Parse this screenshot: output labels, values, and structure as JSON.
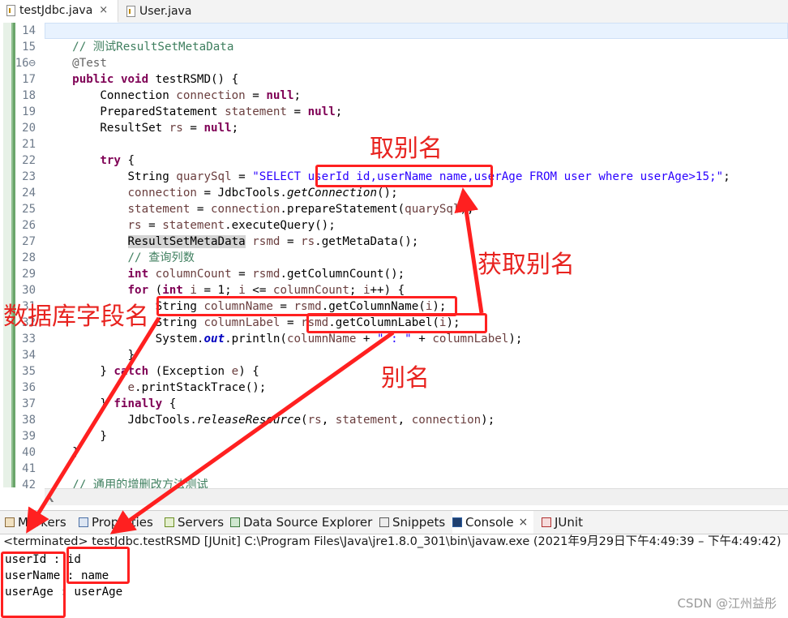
{
  "editor_tabs": [
    {
      "label": "testJdbc.java",
      "close": "×",
      "active": true
    },
    {
      "label": "User.java",
      "active": false
    }
  ],
  "code_lines": [
    {
      "n": "14",
      "t": []
    },
    {
      "n": "15",
      "t": [
        [
          "    ",
          ""
        ],
        [
          "// 测试ResultSetMetaData",
          "cm"
        ]
      ]
    },
    {
      "n": "16⊖",
      "t": [
        [
          "    ",
          ""
        ],
        [
          "@Test",
          "ann"
        ]
      ]
    },
    {
      "n": "17",
      "t": [
        [
          "    ",
          ""
        ],
        [
          "public",
          "kw"
        ],
        [
          " ",
          ""
        ],
        [
          "void",
          "kw"
        ],
        [
          " testRSMD() {",
          ""
        ]
      ]
    },
    {
      "n": "18",
      "t": [
        [
          "        Connection ",
          ""
        ],
        [
          "connection",
          "var"
        ],
        [
          " = ",
          ""
        ],
        [
          "null",
          "kw"
        ],
        [
          ";",
          ""
        ]
      ]
    },
    {
      "n": "19",
      "t": [
        [
          "        PreparedStatement ",
          ""
        ],
        [
          "statement",
          "var"
        ],
        [
          " = ",
          ""
        ],
        [
          "null",
          "kw"
        ],
        [
          ";",
          ""
        ]
      ]
    },
    {
      "n": "20",
      "t": [
        [
          "        ResultSet ",
          ""
        ],
        [
          "rs",
          "var"
        ],
        [
          " = ",
          ""
        ],
        [
          "null",
          "kw"
        ],
        [
          ";",
          ""
        ]
      ]
    },
    {
      "n": "21",
      "t": []
    },
    {
      "n": "22",
      "t": [
        [
          "        ",
          ""
        ],
        [
          "try",
          "kw"
        ],
        [
          " {",
          ""
        ]
      ]
    },
    {
      "n": "23",
      "t": [
        [
          "            String ",
          ""
        ],
        [
          "quarySql",
          "var"
        ],
        [
          " = ",
          ""
        ],
        [
          "\"SELECT userId id,userName name,userAge FROM user where userAge>15;\"",
          "str"
        ],
        [
          ";",
          ""
        ]
      ]
    },
    {
      "n": "24",
      "t": [
        [
          "            ",
          ""
        ],
        [
          "connection",
          "var"
        ],
        [
          " = JdbcTools.",
          ""
        ],
        [
          "getConnection",
          "it"
        ],
        [
          "();",
          ""
        ]
      ]
    },
    {
      "n": "25",
      "t": [
        [
          "            ",
          ""
        ],
        [
          "statement",
          "var"
        ],
        [
          " = ",
          ""
        ],
        [
          "connection",
          "var"
        ],
        [
          ".prepareStatement(",
          ""
        ],
        [
          "quarySql",
          "var"
        ],
        [
          ");",
          ""
        ]
      ]
    },
    {
      "n": "26",
      "t": [
        [
          "            ",
          ""
        ],
        [
          "rs",
          "var"
        ],
        [
          " = ",
          ""
        ],
        [
          "statement",
          "var"
        ],
        [
          ".executeQuery();",
          ""
        ]
      ]
    },
    {
      "n": "27",
      "t": [
        [
          "            ",
          ""
        ],
        [
          "ResultSetMetaData",
          "hl-box"
        ],
        [
          " ",
          ""
        ],
        [
          "rsmd",
          "var"
        ],
        [
          " = ",
          ""
        ],
        [
          "rs",
          "var"
        ],
        [
          ".getMetaData();",
          ""
        ]
      ]
    },
    {
      "n": "28",
      "t": [
        [
          "            ",
          ""
        ],
        [
          "// 查询列数",
          "cm"
        ]
      ]
    },
    {
      "n": "29",
      "t": [
        [
          "            ",
          ""
        ],
        [
          "int",
          "kw"
        ],
        [
          " ",
          ""
        ],
        [
          "columnCount",
          "var"
        ],
        [
          " = ",
          ""
        ],
        [
          "rsmd",
          "var"
        ],
        [
          ".getColumnCount();",
          ""
        ]
      ]
    },
    {
      "n": "30",
      "t": [
        [
          "            ",
          ""
        ],
        [
          "for",
          "kw"
        ],
        [
          " (",
          ""
        ],
        [
          "int",
          "kw"
        ],
        [
          " ",
          ""
        ],
        [
          "i",
          "var"
        ],
        [
          " = 1; ",
          ""
        ],
        [
          "i",
          "var"
        ],
        [
          " <= ",
          ""
        ],
        [
          "columnCount",
          "var"
        ],
        [
          "; ",
          ""
        ],
        [
          "i",
          "var"
        ],
        [
          "++) {",
          ""
        ]
      ]
    },
    {
      "n": "31",
      "t": [
        [
          "                String ",
          ""
        ],
        [
          "columnName",
          "var"
        ],
        [
          " = ",
          ""
        ],
        [
          "rsmd",
          "var"
        ],
        [
          ".getColumnName(",
          ""
        ],
        [
          "i",
          "var"
        ],
        [
          ");",
          ""
        ]
      ]
    },
    {
      "n": "32",
      "t": [
        [
          "                String ",
          ""
        ],
        [
          "columnLabel",
          "var"
        ],
        [
          " = ",
          ""
        ],
        [
          "rsmd",
          "var"
        ],
        [
          ".getColumnLabel(",
          ""
        ],
        [
          "i",
          "var"
        ],
        [
          ");",
          ""
        ]
      ]
    },
    {
      "n": "33",
      "t": [
        [
          "                System.",
          ""
        ],
        [
          "out",
          "sfi"
        ],
        [
          ".println(",
          ""
        ],
        [
          "columnName",
          "var"
        ],
        [
          " + ",
          ""
        ],
        [
          "\" : \"",
          "str"
        ],
        [
          " + ",
          ""
        ],
        [
          "columnLabel",
          "var"
        ],
        [
          ");",
          ""
        ]
      ]
    },
    {
      "n": "34",
      "t": [
        [
          "            }",
          ""
        ]
      ]
    },
    {
      "n": "35",
      "t": [
        [
          "        } ",
          ""
        ],
        [
          "catch",
          "kw"
        ],
        [
          " (Exception ",
          ""
        ],
        [
          "e",
          "var"
        ],
        [
          ") {",
          ""
        ]
      ]
    },
    {
      "n": "36",
      "t": [
        [
          "            ",
          ""
        ],
        [
          "e",
          "var"
        ],
        [
          ".printStackTrace();",
          ""
        ]
      ]
    },
    {
      "n": "37",
      "t": [
        [
          "        } ",
          ""
        ],
        [
          "finally",
          "kw"
        ],
        [
          " {",
          ""
        ]
      ]
    },
    {
      "n": "38",
      "t": [
        [
          "            JdbcTools.",
          ""
        ],
        [
          "releaseResource",
          "it"
        ],
        [
          "(",
          ""
        ],
        [
          "rs",
          "var"
        ],
        [
          ", ",
          ""
        ],
        [
          "statement",
          "var"
        ],
        [
          ", ",
          ""
        ],
        [
          "connection",
          "var"
        ],
        [
          ");",
          ""
        ]
      ]
    },
    {
      "n": "39",
      "t": [
        [
          "        }",
          ""
        ]
      ]
    },
    {
      "n": "40",
      "t": [
        [
          "    }",
          ""
        ]
      ]
    },
    {
      "n": "41",
      "t": []
    },
    {
      "n": "42",
      "t": [
        [
          "    ",
          ""
        ],
        [
          "// 通用的增删改方法测试",
          "cm"
        ]
      ]
    }
  ],
  "panel_tabs": [
    {
      "label": "Markers",
      "icon": "markers-icon",
      "color": "#8a6a3a"
    },
    {
      "label": "Properties",
      "icon": "properties-icon",
      "color": "#4a6fa5"
    },
    {
      "label": "Servers",
      "icon": "servers-icon",
      "color": "#6b8e23"
    },
    {
      "label": "Data Source Explorer",
      "icon": "data-source-icon",
      "color": "#3c7a3c"
    },
    {
      "label": "Snippets",
      "icon": "snippets-icon",
      "color": "#5a5a5a"
    },
    {
      "label": "Console",
      "icon": "console-icon",
      "color": "#2f5fa0",
      "close": "×",
      "active": true
    },
    {
      "label": "JUnit",
      "icon": "junit-icon",
      "color": "#b03030"
    }
  ],
  "console_status": "<terminated> testJdbc.testRSMD [JUnit] C:\\Program Files\\Java\\jre1.8.0_301\\bin\\javaw.exe  (2021年9月29日下午4:49:39 – 下午4:49:42)",
  "console_output": [
    "userId : id",
    "userName : name",
    "userAge : userAge"
  ],
  "annotations": {
    "alias": "取别名",
    "get_alias": "获取别名",
    "db_field_name": "数据库字段名",
    "alias_short": "别名"
  },
  "watermark": "CSDN @江州益彤",
  "colors": {
    "annotation": "#ff2020",
    "keyword": "#7f0055",
    "comment": "#3f7f5f",
    "string": "#2a00ff"
  }
}
